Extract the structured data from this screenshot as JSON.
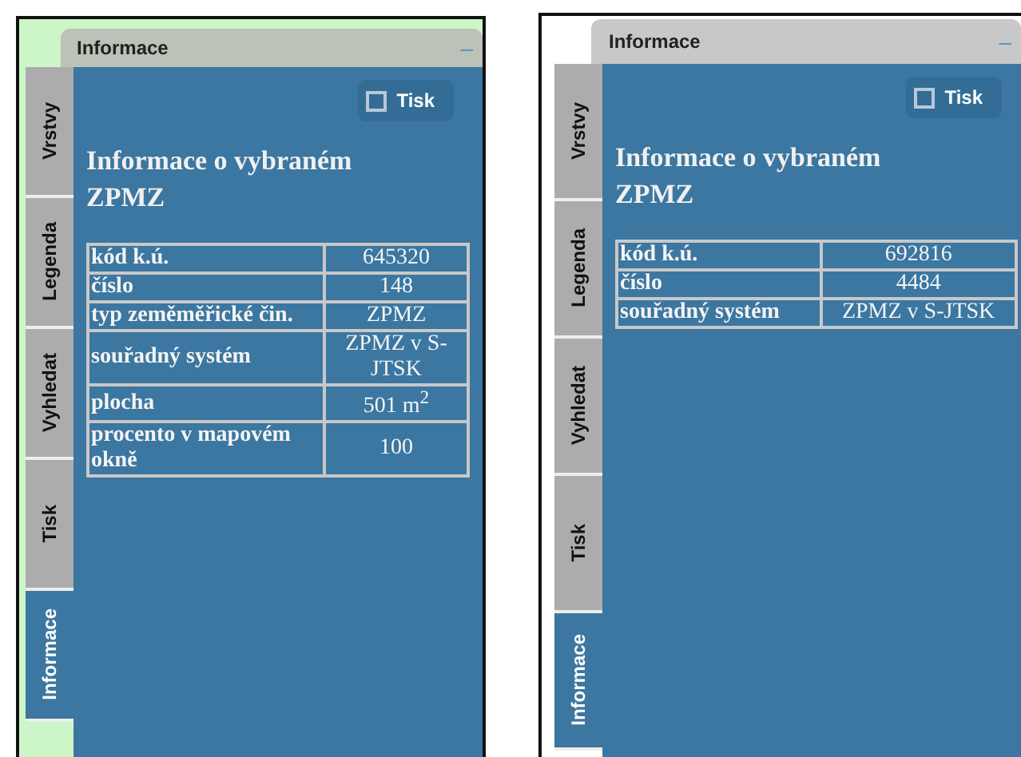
{
  "panels": [
    {
      "title": "Informace",
      "minimize": "–",
      "tabs": [
        {
          "label": "Vrstvy",
          "selected": false
        },
        {
          "label": "Legenda",
          "selected": false
        },
        {
          "label": "Vyhledat",
          "selected": false
        },
        {
          "label": "Tisk",
          "selected": false
        },
        {
          "label": "Informace",
          "selected": true
        }
      ],
      "print_button": {
        "label": "Tisk",
        "checked": false
      },
      "heading": "Informace o vybraném ZPMZ",
      "rows": [
        {
          "label": "kód k.ú.",
          "value": "645320"
        },
        {
          "label": "číslo",
          "value": "148"
        },
        {
          "label": "typ zeměměřické čin.",
          "value": "ZPMZ"
        },
        {
          "label": "souřadný systém",
          "value": "ZPMZ v S-JTSK"
        },
        {
          "label": "plocha",
          "value": "501 m$^{2}$"
        },
        {
          "label": "procento v mapovém okně",
          "value": "100"
        }
      ]
    },
    {
      "title": "Informace",
      "minimize": "–",
      "tabs": [
        {
          "label": "Vrstvy",
          "selected": false
        },
        {
          "label": "Legenda",
          "selected": false
        },
        {
          "label": "Vyhledat",
          "selected": false
        },
        {
          "label": "Tisk",
          "selected": false
        },
        {
          "label": "Informace",
          "selected": true
        }
      ],
      "print_button": {
        "label": "Tisk",
        "checked": false
      },
      "heading": "Informace o vybraném ZPMZ",
      "rows": [
        {
          "label": "kód k.ú.",
          "value": "692816"
        },
        {
          "label": "číslo",
          "value": "4484"
        },
        {
          "label": "souřadný systém",
          "value": "ZPMZ v S-JTSK"
        }
      ]
    }
  ]
}
